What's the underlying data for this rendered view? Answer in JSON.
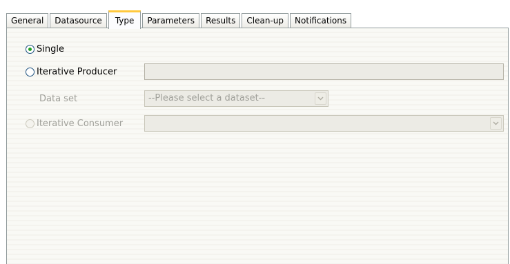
{
  "tabs": [
    {
      "label": "General"
    },
    {
      "label": "Datasource"
    },
    {
      "label": "Type",
      "active": true
    },
    {
      "label": "Parameters"
    },
    {
      "label": "Results"
    },
    {
      "label": "Clean-up"
    },
    {
      "label": "Notifications"
    }
  ],
  "type_panel": {
    "single_label": "Single",
    "single_selected": true,
    "iterative_producer_label": "Iterative Producer",
    "iterative_producer_value": "",
    "data_set_label": "Data set",
    "data_set_selected": "--Please select a dataset--",
    "iterative_consumer_label": "Iterative Consumer",
    "iterative_consumer_value": ""
  },
  "colors": {
    "active_tab_accent": "#ffc83c",
    "radio_dot": "#21a121",
    "disabled_text": "#a0a09a"
  }
}
